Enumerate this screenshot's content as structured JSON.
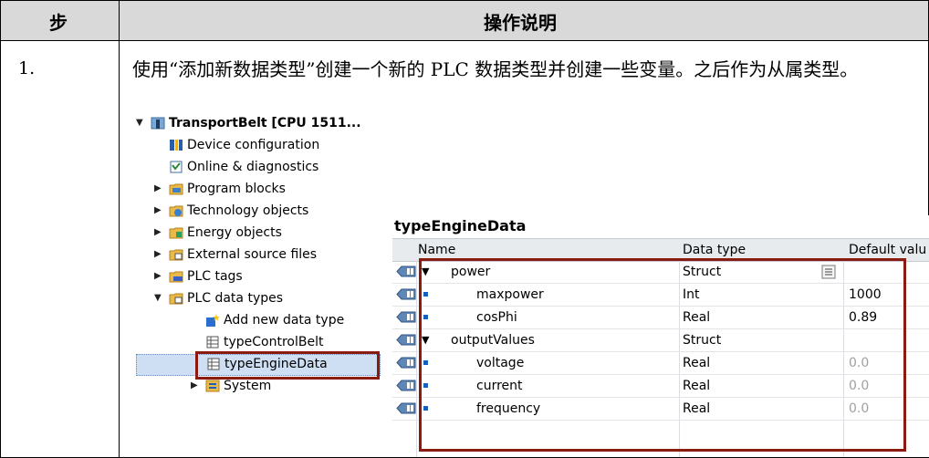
{
  "table": {
    "col_step": "步",
    "col_desc": "操作说明",
    "row_step": "1.",
    "row_desc": "使用“添加新数据类型”创建一个新的 PLC 数据类型并创建一些变量。之后作为从属类型。"
  },
  "tree": {
    "root": "TransportBelt [CPU 1511...",
    "items": [
      {
        "label": "Device configuration",
        "icon": "device-config-icon"
      },
      {
        "label": "Online & diagnostics",
        "icon": "online-diagnostics-icon"
      },
      {
        "label": "Program blocks",
        "icon": "folder-icon"
      },
      {
        "label": "Technology objects",
        "icon": "folder-icon"
      },
      {
        "label": "Energy objects",
        "icon": "folder-icon"
      },
      {
        "label": "External source files",
        "icon": "folder-icon"
      },
      {
        "label": "PLC tags",
        "icon": "folder-icon"
      },
      {
        "label": "PLC data types",
        "icon": "folder-icon"
      },
      {
        "label": "Add new data type",
        "icon": "add-icon"
      },
      {
        "label": "typeControlBelt",
        "icon": "datatype-icon"
      },
      {
        "label": "typeEngineData",
        "icon": "datatype-icon"
      },
      {
        "label": "System",
        "icon": "folder-icon"
      }
    ]
  },
  "struct": {
    "title": "typeEngineData",
    "headers": [
      "Name",
      "Data type",
      "Default valu"
    ],
    "rows": [
      {
        "name": "power",
        "type": "Struct",
        "default": ""
      },
      {
        "name": "maxpower",
        "type": "Int",
        "default": "1000"
      },
      {
        "name": "cosPhi",
        "type": "Real",
        "default": "0.89"
      },
      {
        "name": "outputValues",
        "type": "Struct",
        "default": ""
      },
      {
        "name": "voltage",
        "type": "Real",
        "default": "0.0"
      },
      {
        "name": "current",
        "type": "Real",
        "default": "0.0"
      },
      {
        "name": "frequency",
        "type": "Real",
        "default": "0.0"
      }
    ]
  },
  "colors": {
    "highlight_box": "#8b1a10",
    "selection": "#cfdff3",
    "header_bg": "#d9d9d9"
  }
}
